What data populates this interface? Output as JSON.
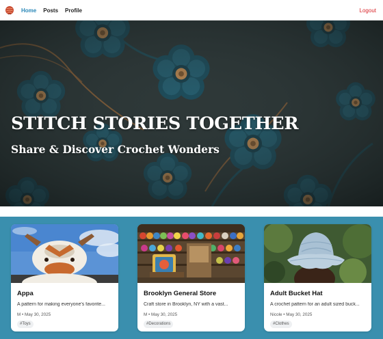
{
  "nav": {
    "links": [
      {
        "label": "Home",
        "active": true
      },
      {
        "label": "Posts",
        "active": false
      },
      {
        "label": "Profile",
        "active": false
      }
    ],
    "logout_label": "Logout",
    "accent_color": "#2b88b8",
    "logout_color": "#d9262b"
  },
  "hero": {
    "title": "STITCH STORIES TOGETHER",
    "subtitle": "Share & Discover Crochet Wonders"
  },
  "cards": [
    {
      "title": "Appa",
      "description": "A pattern for making everyone's favorite...",
      "author": "M",
      "date": "May 30, 2025",
      "tag": "#Toys"
    },
    {
      "title": "Brooklyn General Store",
      "description": "Craft store in Brooklyn, NY with a vast...",
      "author": "M",
      "date": "May 30, 2025",
      "tag": "#Decorations"
    },
    {
      "title": "Adult Bucket Hat",
      "description": "A crochet pattern for an adult sized buck...",
      "author": "Nicole",
      "date": "May 30, 2025",
      "tag": "#Clothes"
    }
  ],
  "section_color": "#3a8fae"
}
